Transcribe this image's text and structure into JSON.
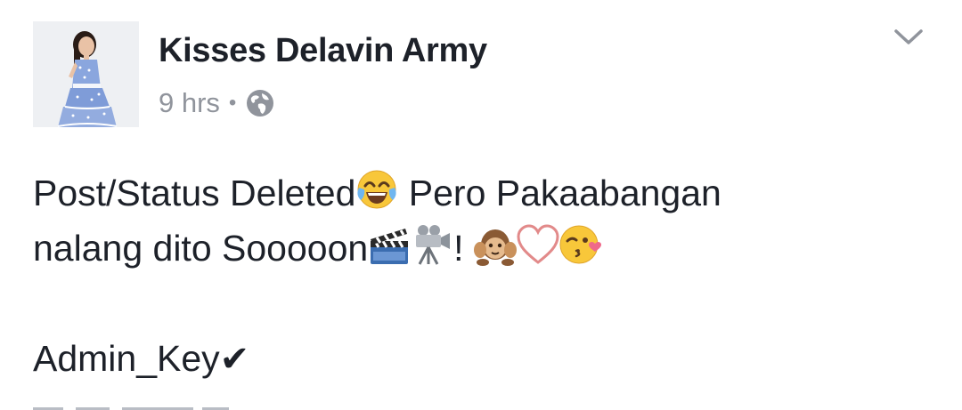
{
  "post": {
    "page_name": "Kisses Delavin Army",
    "timestamp": "9 hrs",
    "separator": "•",
    "privacy_icon": "globe-icon",
    "menu_icon": "chevron-down-icon",
    "avatar_icon": "profile-photo",
    "text": {
      "line1_a": "Post/Status Deleted",
      "line1_emoji": "face-with-tears-of-joy",
      "line1_b": " Pero Pakaabangan",
      "line2_a": "nalang dito Sooooon",
      "line2_emoji1": "clapper-board",
      "line2_emoji2": "movie-camera",
      "line2_b": "! ",
      "line2_emoji3": "hear-no-evil-monkey",
      "line2_emoji4": "white-heart",
      "line2_emoji5": "face-blowing-kiss",
      "signature": "Admin_Key",
      "signature_check": "✔"
    }
  },
  "colors": {
    "text_primary": "#1d2129",
    "text_secondary": "#90949c",
    "background": "#ffffff"
  }
}
